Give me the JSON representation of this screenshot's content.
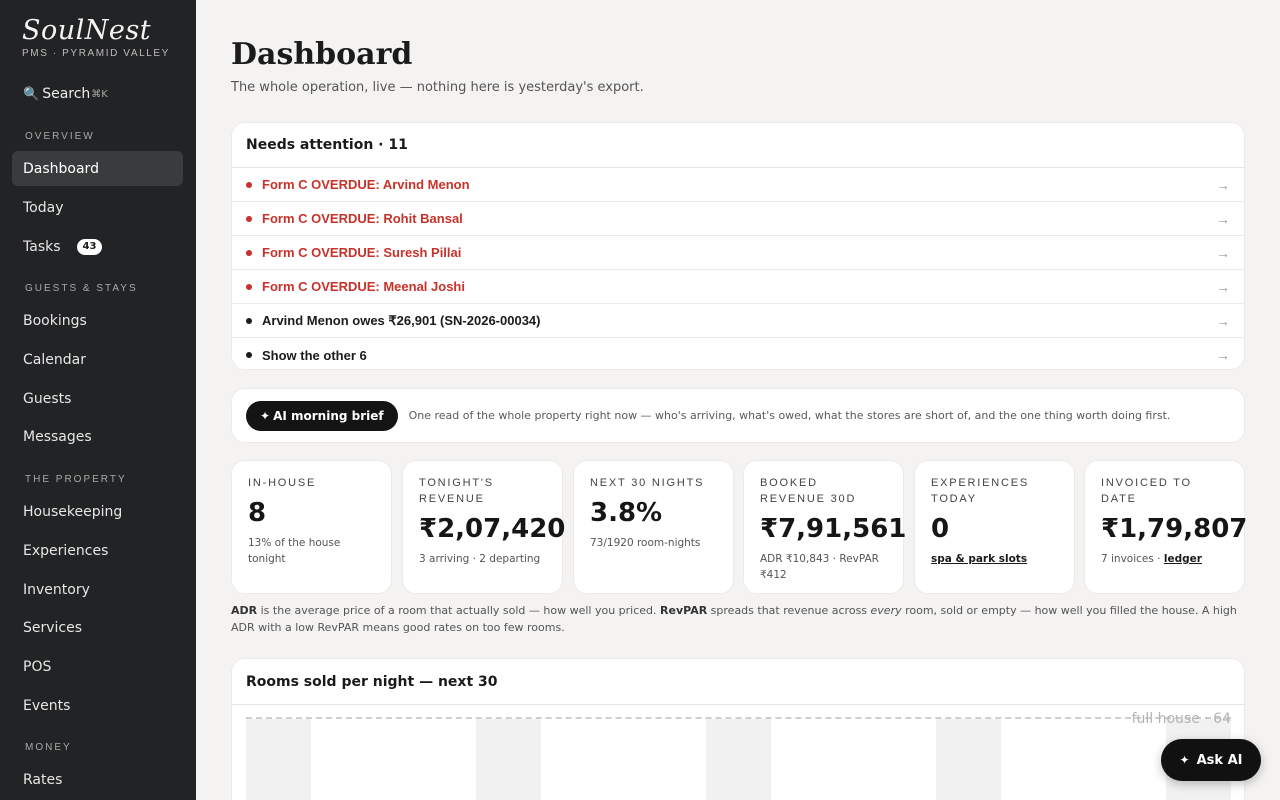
{
  "sidebar": {
    "brand": "SoulNest",
    "brand_sub": "PMS · PYRAMID VALLEY",
    "search_label": "Search",
    "search_kbd": "⌘K",
    "sections": {
      "overview": "OVERVIEW",
      "guests": "GUESTS & STAYS",
      "property": "THE PROPERTY",
      "money": "MONEY"
    },
    "items": {
      "dashboard": "Dashboard",
      "today": "Today",
      "tasks": "Tasks",
      "tasks_count": "43",
      "bookings": "Bookings",
      "calendar": "Calendar",
      "guests": "Guests",
      "messages": "Messages",
      "housekeeping": "Housekeeping",
      "experiences": "Experiences",
      "inventory": "Inventory",
      "services": "Services",
      "pos": "POS",
      "events": "Events",
      "rates": "Rates"
    }
  },
  "header": {
    "title": "Dashboard",
    "subtitle": "The whole operation, live — nothing here is yesterday's export."
  },
  "attention": {
    "title": "Needs attention · 11",
    "rows": [
      {
        "label": "Form C OVERDUE: Arvind Menon",
        "arrow": "→"
      },
      {
        "label": "Form C OVERDUE: Rohit Bansal",
        "arrow": "→"
      },
      {
        "label": "Form C OVERDUE: Suresh Pillai",
        "arrow": "→"
      },
      {
        "label": "Form C OVERDUE: Meenal Joshi",
        "arrow": "→"
      },
      {
        "label": "Arvind Menon owes ₹26,901 (SN-2026-00034)",
        "arrow": "→"
      },
      {
        "label": "Show the other 6",
        "arrow": "→"
      }
    ]
  },
  "brief": {
    "button": "AI morning brief",
    "text": "One read of the whole property right now — who's arriving, what's owed, what the stores are short of, and the one thing worth doing first."
  },
  "kpis": {
    "in_house": {
      "label": "IN-HOUSE",
      "value": "8",
      "sub": "13% of the house tonight"
    },
    "revenue": {
      "label": "TONIGHT'S REVENUE",
      "value": "₹2,07,420",
      "sub": "3 arriving · 2 departing"
    },
    "next30": {
      "label": "NEXT 30 NIGHTS",
      "value": "3.8%",
      "sub": "73/1920 room-nights"
    },
    "booked": {
      "label": "BOOKED REVENUE 30D",
      "value": "₹7,91,561",
      "sub": "ADR ₹10,843 · RevPAR ₹412"
    },
    "experiences": {
      "label": "EXPERIENCES TODAY",
      "value": "0",
      "sub_link": "spa & park slots"
    },
    "invoiced": {
      "label": "INVOICED TO DATE",
      "value": "₹1,79,807",
      "sub": "7 invoices · ",
      "sub_link": "ledger"
    }
  },
  "explain": {
    "adr": "ADR",
    "p1": " is the average price of a room that actually sold — how well you priced. ",
    "revpar": "RevPAR",
    "p2": " spreads that revenue across ",
    "every": "every",
    "p3": " room, sold or empty — how well you filled the house. A high ADR with a low RevPAR means good rates on too few rooms."
  },
  "rooms_chart": {
    "title": "Rooms sold per night — next 30",
    "full_house_label": "full house · 64"
  },
  "ask_ai": "Ask AI"
}
